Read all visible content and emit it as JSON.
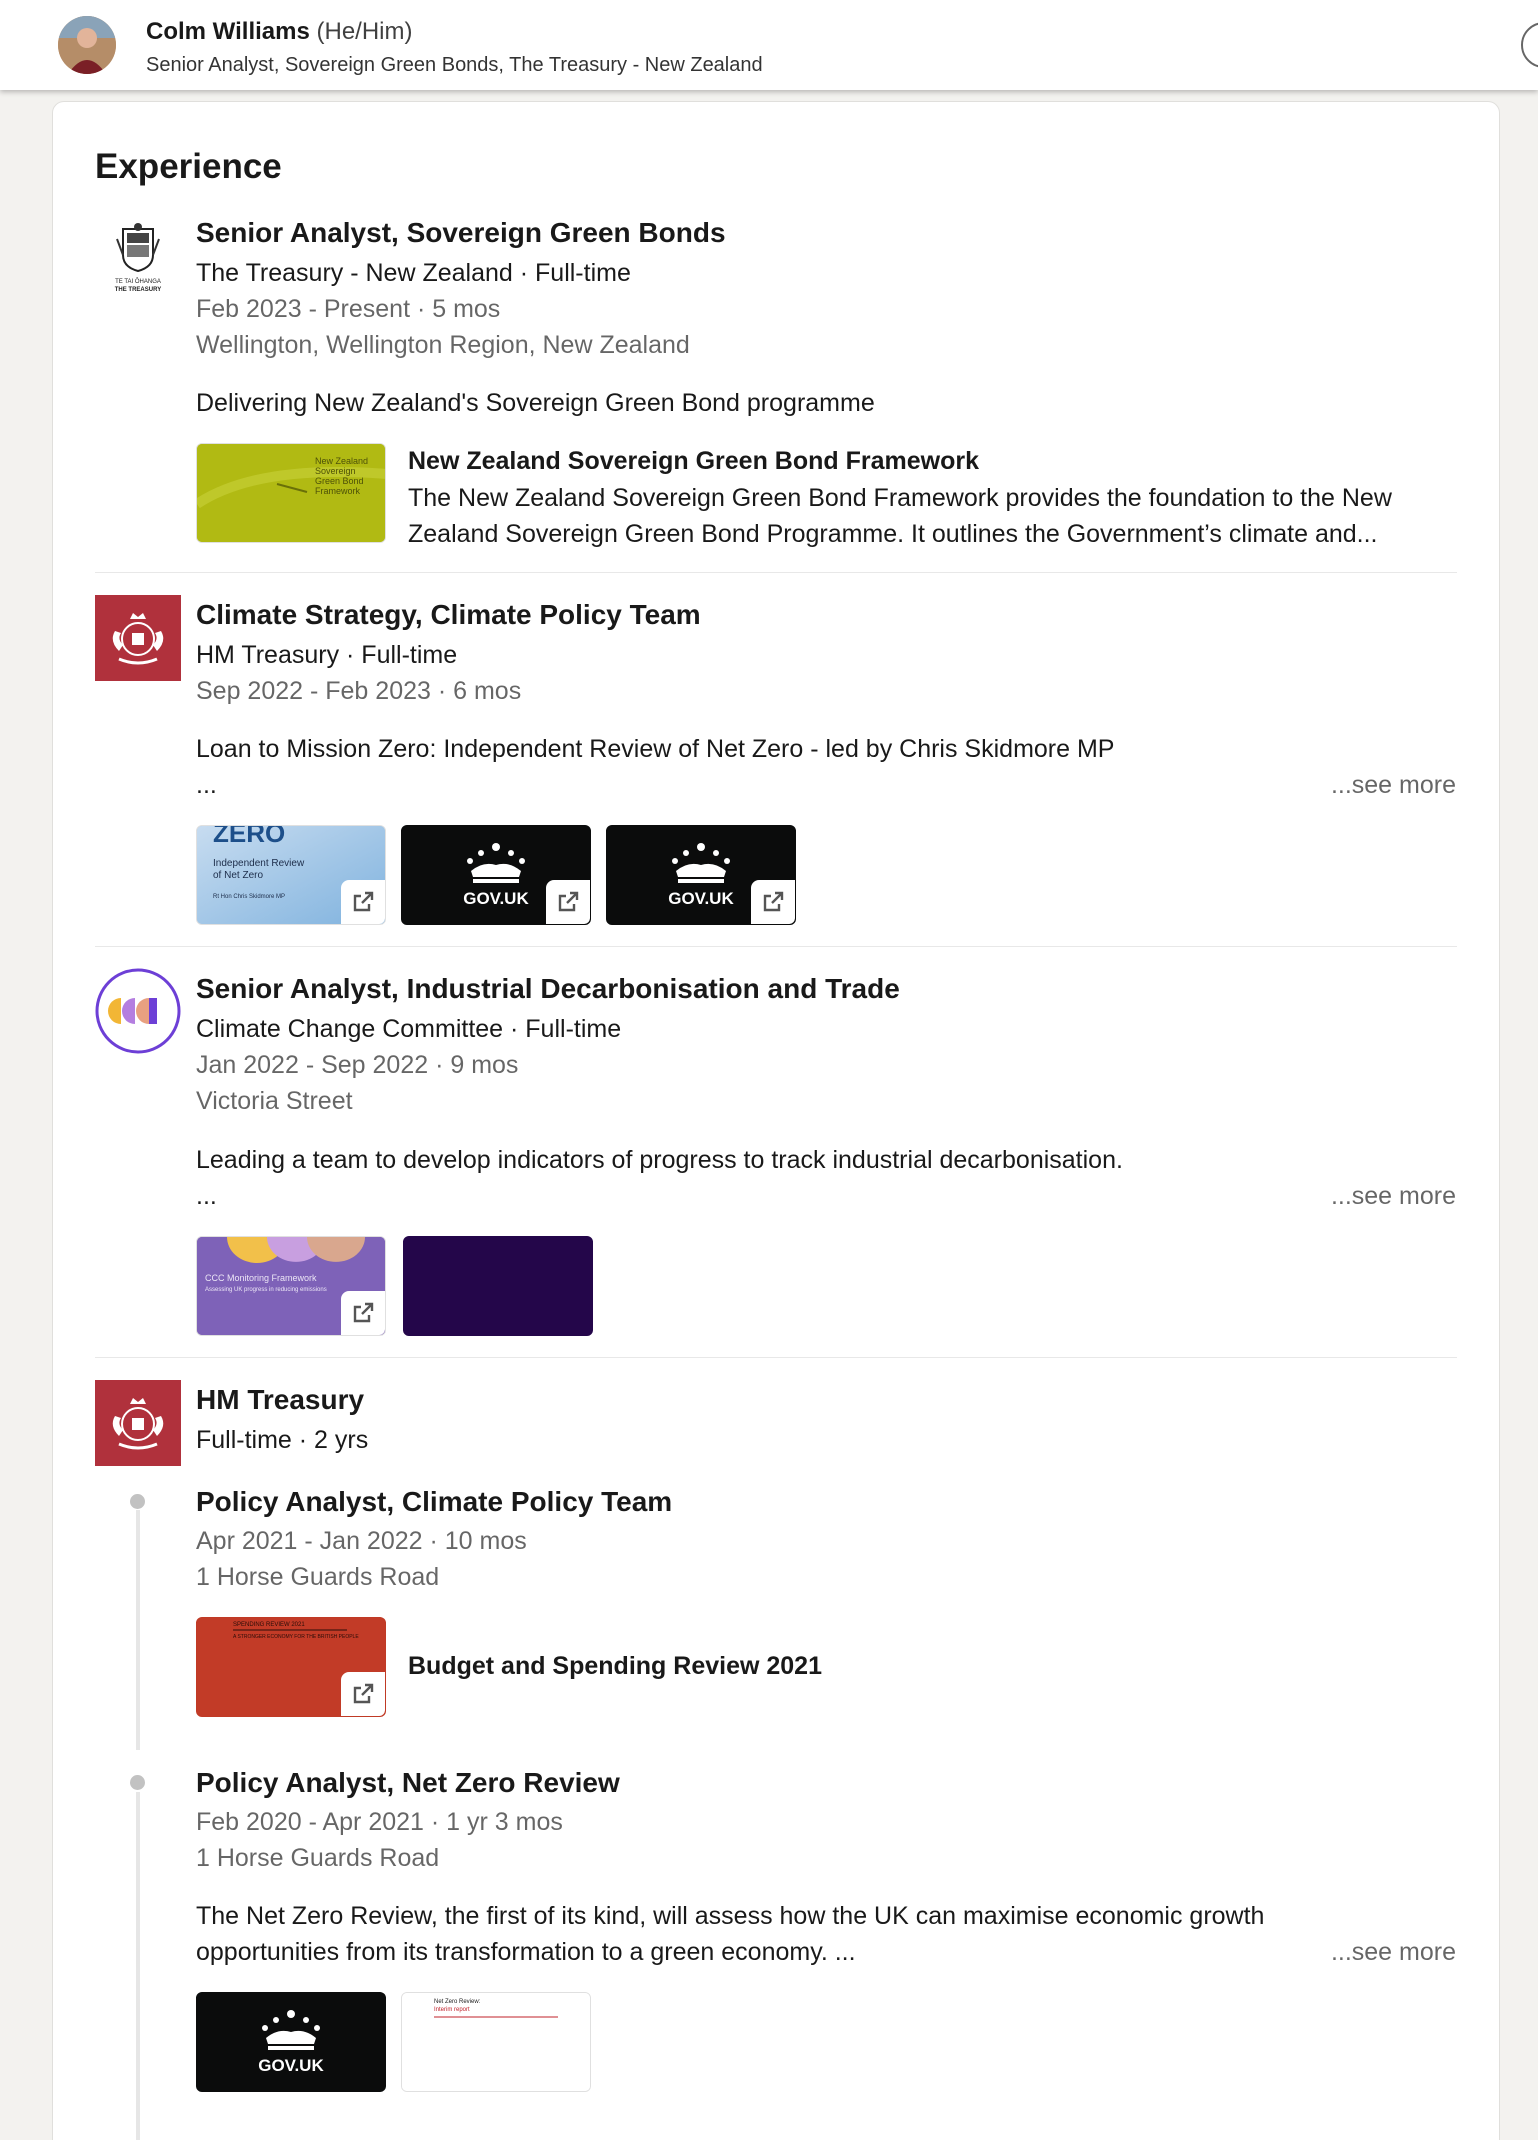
{
  "top_bar": {
    "name": "Colm Williams",
    "pronouns": "(He/Him)",
    "headline": "Senior Analyst, Sovereign Green Bonds, The Treasury - New Zealand"
  },
  "section_title": "Experience",
  "see_more": "...see more",
  "ellipsis": "...",
  "experiences": [
    {
      "role": "Senior Analyst, Sovereign Green Bonds",
      "company": "The Treasury - New Zealand · Full-time",
      "dates": "Feb 2023 - Present · 5 mos",
      "location": "Wellington, Wellington Region, New Zealand",
      "description": "Delivering New Zealand's Sovereign Green Bond programme",
      "media_title": "New Zealand Sovereign Green Bond Framework",
      "media_desc": "The New Zealand Sovereign Green Bond Framework provides the foundation to the New Zealand Sovereign Green Bond Programme. It outlines the Government’s climate and...",
      "thumb_text": "New Zealand Sovereign Green Bond Framework",
      "logo_caption": "TE TAI ŌHANGA THE TREASURY"
    },
    {
      "role": "Climate Strategy, Climate Policy Team",
      "company": "HM Treasury · Full-time",
      "dates": "Sep 2022 - Feb 2023 · 6 mos",
      "description": "Loan to Mission Zero: Independent Review of Net Zero - led by Chris Skidmore MP",
      "thumb1_title": "ZERO",
      "thumb1_sub": "Independent Review of Net Zero",
      "thumb1_small": "Rt Hon Chris Skidmore MP",
      "gov_label": "GOV.UK"
    },
    {
      "role": "Senior Analyst, Industrial Decarbonisation and Trade",
      "company": "Climate Change Committee · Full-time",
      "dates": "Jan 2022 - Sep 2022 · 9 mos",
      "location": "Victoria Street",
      "description": "Leading a team to develop indicators of progress to track industrial decarbonisation.",
      "thumb_title": "CCC Monitoring Framework",
      "thumb_sub": "Assessing UK progress in reducing emissions"
    },
    {
      "company": "HM Treasury",
      "summary": "Full-time · 2 yrs",
      "positions": [
        {
          "role": "Policy Analyst, Climate Policy Team",
          "dates": "Apr 2021 - Jan 2022 · 10 mos",
          "location": "1 Horse Guards Road",
          "media_title": "Budget and Spending Review 2021",
          "thumb_title": "SPENDING REVIEW 2021",
          "thumb_sub": "A STRONGER ECONOMY FOR THE BRITISH PEOPLE"
        },
        {
          "role": "Policy Analyst, Net Zero Review",
          "dates": "Feb 2020 - Apr 2021 · 1 yr 3 mos",
          "location": "1 Horse Guards Road",
          "description_line1": "The Net Zero Review, the first of its kind, will assess how the UK can maximise economic growth",
          "description_line2": "opportunities from its transformation to a green economy. ...",
          "gov_label": "GOV.UK",
          "doc_title": "Net Zero Review:",
          "doc_sub": "Interim report"
        }
      ]
    }
  ]
}
